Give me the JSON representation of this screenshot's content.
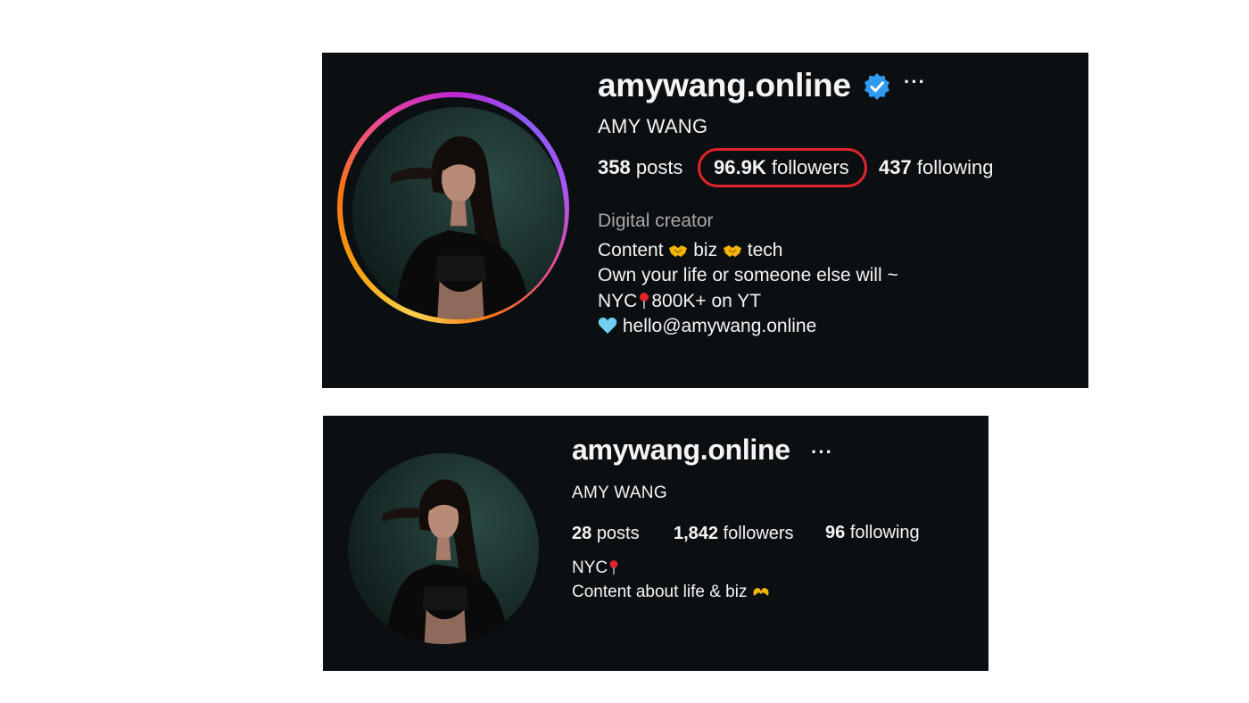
{
  "profile_new": {
    "username": "amywang.online",
    "full_name": "AMY WANG",
    "more_label": "···",
    "stats": {
      "posts_count": "358",
      "posts_label": "posts",
      "followers_count": "96.9K",
      "followers_label": "followers",
      "following_count": "437",
      "following_label": "following"
    },
    "category": "Digital creator",
    "bio": {
      "line1_a": "Content",
      "line1_b": "biz",
      "line1_c": "tech",
      "line2": "Own your life or someone else will ~",
      "line3_a": "NYC",
      "line3_b": "800K+ on YT",
      "line4": "hello@amywang.online"
    },
    "highlight_color": "#e0242b",
    "verified_color": "#2f9bf0"
  },
  "profile_old": {
    "username": "amywang.online",
    "full_name": "AMY WANG",
    "more_label": "···",
    "stats": {
      "posts_count": "28",
      "posts_label": "posts",
      "followers_count": "1,842",
      "followers_label": "followers",
      "following_count": "96",
      "following_label": "following"
    },
    "bio": {
      "line1": "NYC",
      "line2": "Content about life & biz"
    }
  },
  "colors": {
    "panel_bg": "#0b0f12",
    "text": "#f5f5f5",
    "muted": "#a8a8a8"
  }
}
